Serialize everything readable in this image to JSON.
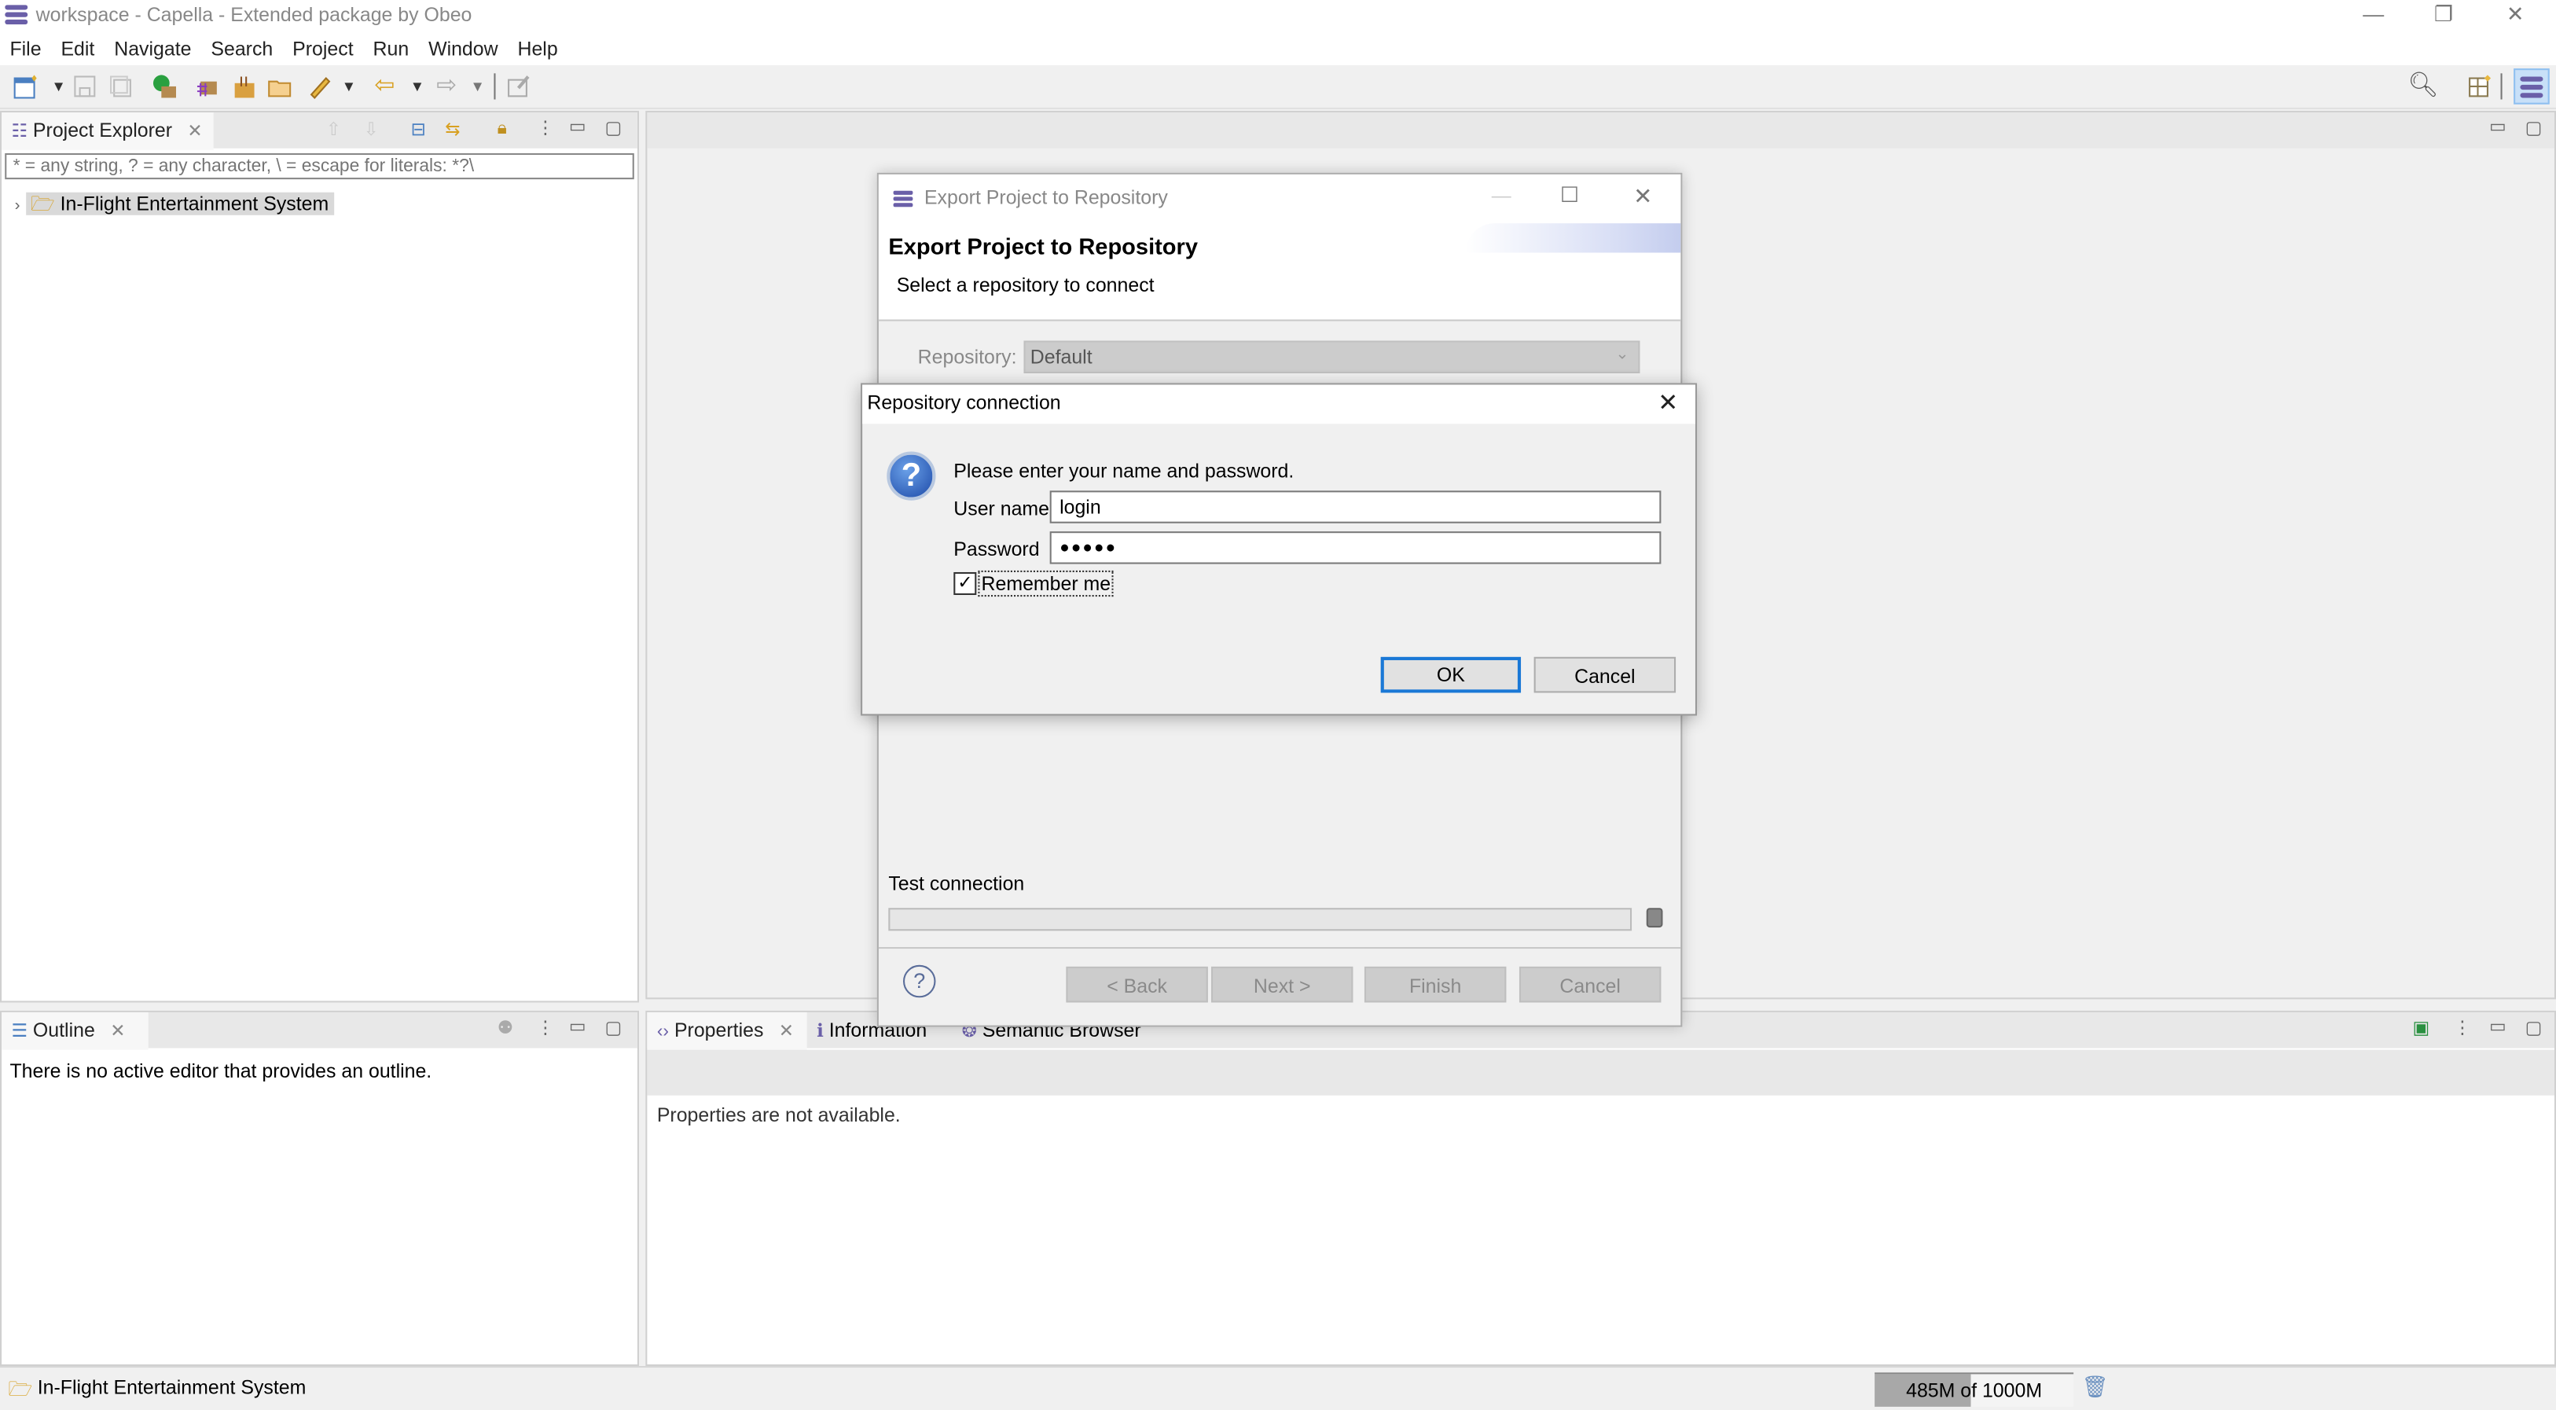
{
  "window": {
    "title": "workspace - Capella - Extended package by Obeo",
    "controls": {
      "minimize": "—",
      "restore": "❐",
      "close": "✕"
    }
  },
  "menubar": {
    "items": [
      {
        "label": "File"
      },
      {
        "label": "Edit"
      },
      {
        "label": "Navigate"
      },
      {
        "label": "Search"
      },
      {
        "label": "Project"
      },
      {
        "label": "Run"
      },
      {
        "label": "Window"
      },
      {
        "label": "Help"
      }
    ]
  },
  "toolbar": {
    "icons": [
      "new-icon",
      "save-icon",
      "save-all-icon",
      "run-icon",
      "capella-icon-1",
      "capella-icon-2",
      "open-folder-icon",
      "pen-icon",
      "back-icon",
      "forward-icon",
      "edit-icon"
    ],
    "right_icons": [
      "search-icon",
      "open-perspective-icon",
      "capella-perspective-icon"
    ]
  },
  "project_explorer": {
    "tab_label": "Project Explorer",
    "filter_placeholder": "* = any string, ? = any character, \\ = escape for literals: *?\\",
    "tree": [
      {
        "label": "In-Flight Entertainment System",
        "expanded": false,
        "selected": true
      }
    ]
  },
  "outline": {
    "tab_label": "Outline",
    "message": "There is no active editor that provides an outline."
  },
  "bottom_panel": {
    "tabs": [
      {
        "label": "Properties",
        "active": true
      },
      {
        "label": "Information",
        "active": false
      },
      {
        "label": "Semantic Browser",
        "active": false
      }
    ],
    "message": "Properties are not available."
  },
  "export_dialog": {
    "window_title": "Export Project to Repository",
    "heading": "Export Project to Repository",
    "subheading": "Select a repository to connect",
    "repository_label": "Repository:",
    "repository_value": "Default",
    "test_connection_label": "Test connection",
    "buttons": {
      "back": "< Back",
      "next": "Next >",
      "finish": "Finish",
      "cancel": "Cancel"
    }
  },
  "login_dialog": {
    "title": "Repository connection",
    "prompt": "Please enter your name and password.",
    "username_label": "User name",
    "username_value": "login",
    "password_label": "Password",
    "password_value": "●●●●●",
    "remember_label": "Remember me",
    "remember_checked": true,
    "ok_label": "OK",
    "cancel_label": "Cancel"
  },
  "statusbar": {
    "selection": "In-Flight Entertainment System",
    "heap_text": "485M of 1000M",
    "heap_used_fraction": 0.485
  }
}
